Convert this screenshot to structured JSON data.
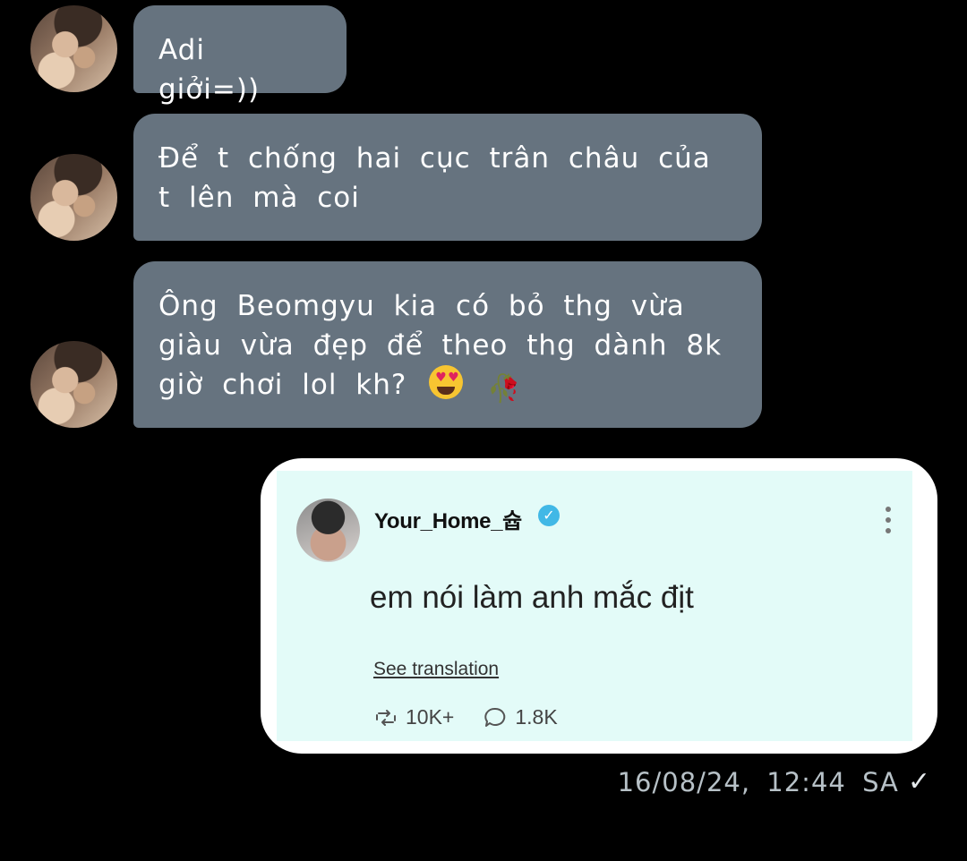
{
  "messages": [
    {
      "text": "Adi giởi=))"
    },
    {
      "text": "Để t chống hai cục trân châu của t lên mà coi"
    },
    {
      "text": "Ông Beomgyu kia có bỏ thg vừa giàu vừa đẹp để theo thg dành 8k giờ chơi lol kh?"
    }
  ],
  "shared_post": {
    "username": "Your_Home_슙",
    "text": "em nói làm anh mắc địt",
    "translate_link": "See translation",
    "reposts": "10K+",
    "replies": "1.8K"
  },
  "sent_timestamp": "16/08/24, 12:44 SA",
  "colors": {
    "incoming_bubble": "#66737f",
    "card_bg": "#e3fbf8",
    "verified": "#41b8e6"
  }
}
